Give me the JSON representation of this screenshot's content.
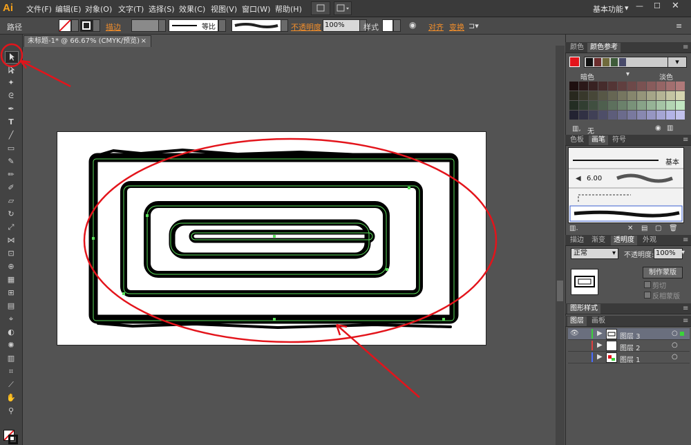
{
  "app": {
    "logo": "Ai",
    "workspace": "基本功能"
  },
  "menu": [
    "文件(F)",
    "编辑(E)",
    "对象(O)",
    "文字(T)",
    "选择(S)",
    "效果(C)",
    "视图(V)",
    "窗口(W)",
    "帮助(H)"
  ],
  "control_bar": {
    "object_type": "路径",
    "stroke_label": "描边",
    "profile_label": "等比",
    "opacity_label": "不透明度",
    "opacity_value": "100%",
    "style_label": "样式",
    "align_label": "对齐",
    "transform_label": "变换"
  },
  "document": {
    "tab_title": "未标题-1* @ 66.67% (CMYK/预览)",
    "close_glyph": "×"
  },
  "color_guide": {
    "tab_color": "颜色",
    "tab_guide": "颜色参考",
    "dark_label": "暗色",
    "light_label": "淡色",
    "none_label": "无",
    "base_color": "#e3141b"
  },
  "brushes": {
    "tab_swatches": "色板",
    "tab_brushes": "画笔",
    "tab_symbols": "符号",
    "basic_label": "基本",
    "size_value": "6.00"
  },
  "transparency": {
    "tab_stroke": "描边",
    "tab_gradient": "渐变",
    "tab_transparency": "透明度",
    "tab_appearance": "外观",
    "blend_mode": "正常",
    "opacity_label": "不透明度:",
    "opacity_value": "100%",
    "make_mask": "制作蒙版",
    "clip_label": "剪切",
    "invert_label": "反相蒙版"
  },
  "graphic_styles": {
    "title": "图形样式"
  },
  "layers": {
    "tab_layers": "图层",
    "tab_artboards": "画板",
    "rows": [
      {
        "name": "图层 3",
        "color": "#3ad33a"
      },
      {
        "name": "图层 2",
        "color": "#e04040"
      },
      {
        "name": "图层 1",
        "color": "#4a6bff"
      }
    ]
  },
  "colors": {
    "accent": "#f7a21b",
    "annotation": "#e3141b",
    "selection": "#5be05b"
  }
}
